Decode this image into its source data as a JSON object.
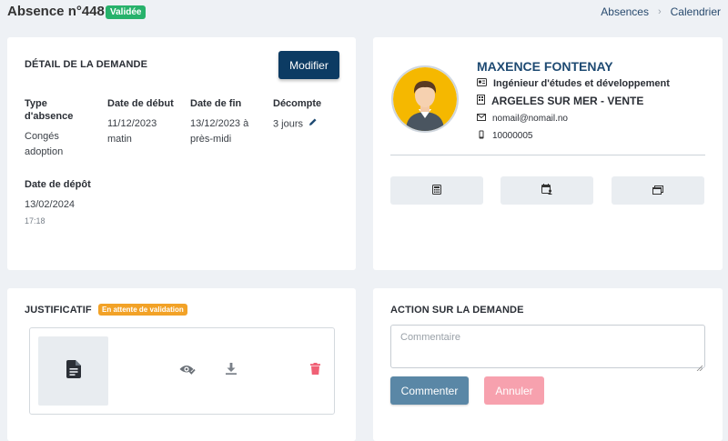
{
  "header": {
    "title": "Absence n°448",
    "status": "Validée",
    "breadcrumb": [
      "Absences",
      "Calendrier"
    ]
  },
  "detail": {
    "title": "DÉTAIL DE LA DEMANDE",
    "edit_label": "Modifier",
    "type_label": "Type d'absence",
    "type_value": "Congés adoption",
    "start_label": "Date de début",
    "start_value": "11/12/2023 matin",
    "end_label": "Date de fin",
    "end_value": "13/12/2023 à près-midi",
    "count_label": "Décompte",
    "count_value": "3 jours",
    "submit_label": "Date de dépôt",
    "submit_date": "13/02/2024",
    "submit_time": "17:18"
  },
  "profile": {
    "name": "MAXENCE FONTENAY",
    "job": "Ingénieur d'études et développement",
    "site": "ARGELES SUR MER - VENTE",
    "email": "nomail@nomail.no",
    "phone": "10000005",
    "icons": [
      "id-card-icon",
      "building-icon",
      "envelope-icon",
      "mobile-icon",
      "calculator-icon",
      "calendar-user-icon",
      "windows-icon"
    ]
  },
  "justificatif": {
    "title": "JUSTIFICATIF",
    "status": "En attente de validation",
    "icons": [
      "file-icon",
      "eye-check-icon",
      "download-icon",
      "trash-icon"
    ]
  },
  "action": {
    "title": "ACTION SUR LA DEMANDE",
    "comment_placeholder": "Commentaire",
    "comment_label": "Commenter",
    "cancel_label": "Annuler"
  },
  "colors": {
    "background": "#eef1f5",
    "primary": "#0c3b63",
    "link": "#284a6e",
    "success": "#27b26b",
    "warning": "#f2a227",
    "danger": "#f06075",
    "comment_btn": "#5a87a6",
    "cancel_btn": "#f7a1ae",
    "avatar_bg": "#f5b800"
  }
}
